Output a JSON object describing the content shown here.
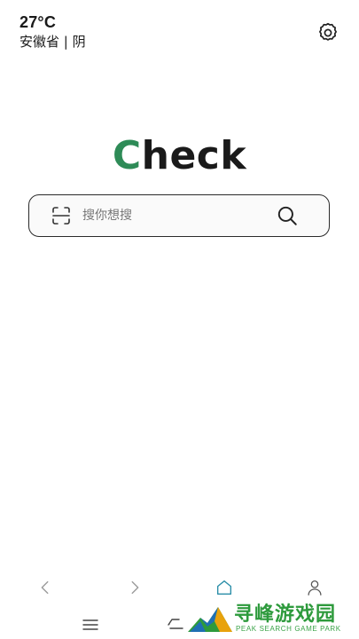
{
  "weather": {
    "temperature": "27°C",
    "location": "安徽省 | 阴"
  },
  "header": {
    "settings_icon": "gear-icon"
  },
  "logo": {
    "first_letter": "C",
    "rest": "heck",
    "accent_color": "#2e8b57"
  },
  "search": {
    "placeholder": "搜你想搜",
    "value": "",
    "scan_icon": "scan-icon",
    "search_icon": "search-icon"
  },
  "bottom_nav": {
    "items": [
      "back-icon",
      "forward-icon",
      "home-icon",
      "profile-icon"
    ]
  },
  "system_bar": {
    "items": [
      "menu-icon",
      "back-gesture-icon"
    ]
  },
  "watermark": {
    "title": "寻峰游戏园",
    "subtitle": "PEAK SEARCH GAME PARK",
    "color": "#2d9a3c"
  }
}
